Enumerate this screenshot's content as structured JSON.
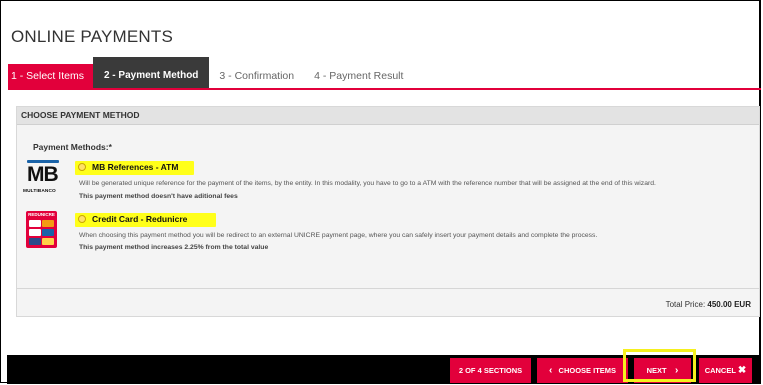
{
  "page": {
    "title": "ONLINE PAYMENTS"
  },
  "wizard": {
    "tabs": [
      {
        "label": "1 - Select Items",
        "state": "done"
      },
      {
        "label": "2 - Payment Method",
        "state": "active"
      },
      {
        "label": "3 - Confirmation",
        "state": "pending"
      },
      {
        "label": "4 - Payment Result",
        "state": "pending"
      }
    ]
  },
  "panel": {
    "header": "CHOOSE PAYMENT METHOD",
    "methods_label": "Payment Methods:*",
    "methods": [
      {
        "title": "MB References - ATM",
        "logo_text": "MB",
        "logo_sub": "MULTIBANCO",
        "description": "Will be generated unique reference for the payment of the items, by the entity. In this modality, you have to go to a ATM with the reference number that will be assigned at the end of this wizard.",
        "note": "This payment method doesn't have aditional fees",
        "selected": false
      },
      {
        "title": "Credit Card - Redunicre",
        "logo_text": "REDUNICRE",
        "description": "When choosing this payment method you will be redirect to an external UNICRE payment page, where you can safely insert your payment details and complete the process.",
        "note": "This payment method increases 2.25% from the total value",
        "selected": false
      }
    ],
    "total_label": "Total Price:",
    "total_value": "450.00 EUR"
  },
  "footer": {
    "sections": "2 OF 4 SECTIONS",
    "back_label": "CHOOSE ITEMS",
    "next_label": "NEXT",
    "cancel_label": "CANCEL"
  },
  "icons": {
    "back": "chevron-left-icon",
    "next": "chevron-right-icon",
    "cancel": "close-icon"
  },
  "colors": {
    "accent": "#e2003b",
    "tab_active": "#3a3a3a",
    "highlight": "#ffff1a",
    "mb_blue": "#1a63a8"
  }
}
